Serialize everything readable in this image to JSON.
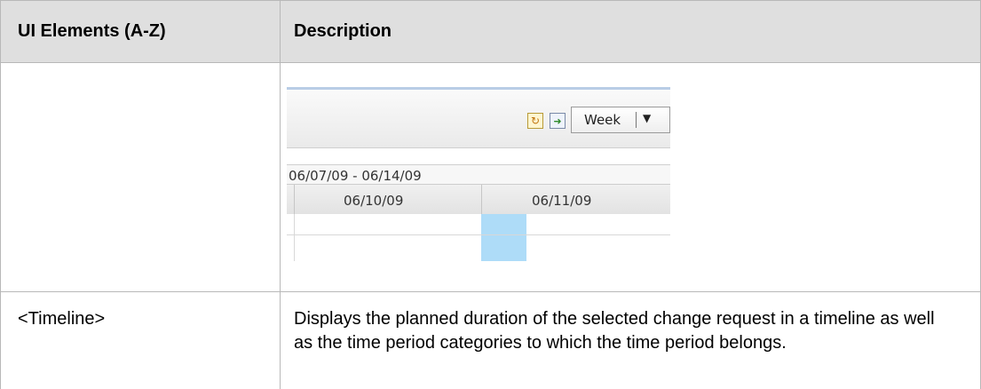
{
  "table": {
    "headers": [
      "UI Elements (A-Z)",
      "Description"
    ],
    "rows": [
      {
        "element": "<Timeline>",
        "description": "Displays the planned duration of the selected change request in a timeline as well as the time period categories to which the time period belongs."
      }
    ]
  },
  "screenshot": {
    "toolbar": {
      "refresh_icon": "refresh-icon",
      "export_icon": "export-icon",
      "view_selector": "Week"
    },
    "date_range": "06/07/09 - 06/14/09",
    "dates": [
      "06/10/09",
      "06/11/09"
    ]
  },
  "colors": {
    "header_bg": "#dfdfdf",
    "grid_line": "#b8b8b8",
    "today_highlight": "#aedcf8"
  }
}
